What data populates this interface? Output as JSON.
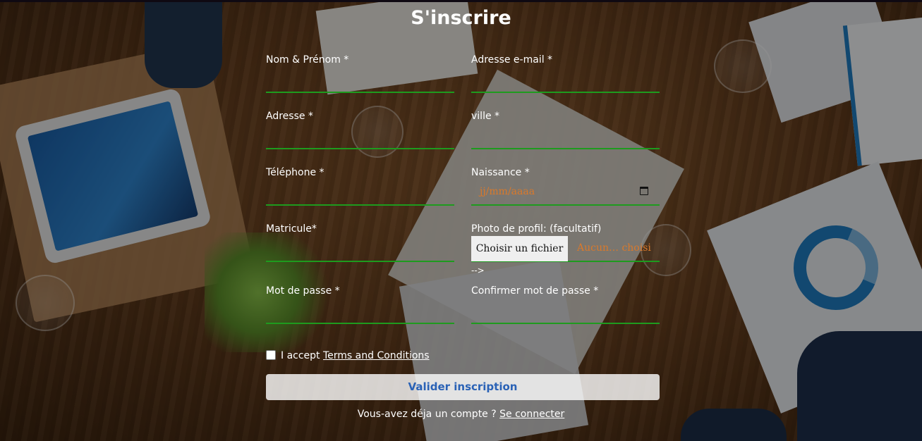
{
  "form": {
    "title": "S'inscrire",
    "fields": {
      "name_label": "Nom & Prénom *",
      "email_label": "Adresse e-mail *",
      "address_label": "Adresse *",
      "city_label": "ville *",
      "phone_label": "Téléphone *",
      "birth_label": "Naissance *",
      "birth_placeholder": "jj/mm/aaaa",
      "matricule_label": "Matricule*",
      "photo_label": "Photo de profil: (facultatif)",
      "file_button": "Choisir un fichier",
      "file_status": "Aucun… choisi",
      "stray_text": "-->",
      "password_label": "Mot de passe *",
      "confirm_label": "Confirmer mot de passe *"
    },
    "terms": {
      "prefix": "I accept ",
      "link": "Terms and Conditions"
    },
    "submit_label": "Valider inscription",
    "signin": {
      "prefix": "Vous-avez déja un compte ? ",
      "link": "Se connecter"
    }
  },
  "colors": {
    "underline": "#1e9b1e",
    "placeholder": "#d9792b",
    "submit_text": "#2a62b6"
  }
}
